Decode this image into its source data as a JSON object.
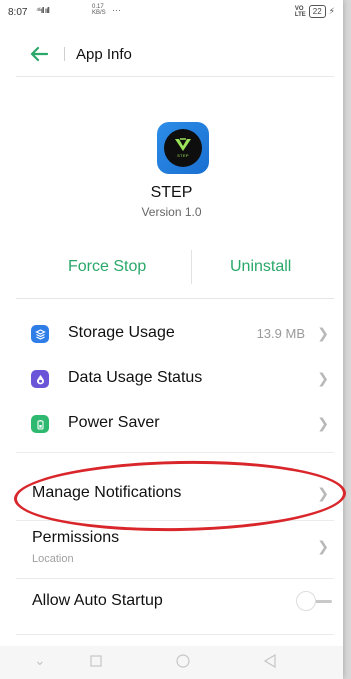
{
  "status_bar": {
    "time": "8:07",
    "network": "⁴⁶ıll ııll",
    "speed_top": "0.17",
    "speed_bottom": "KB/S",
    "dots": "···",
    "volte_top": "VO",
    "volte_bottom": "LTE",
    "battery": "22"
  },
  "header": {
    "title": "App Info",
    "back_icon": "arrow-left-icon"
  },
  "app": {
    "icon_text": "STEP",
    "name": "STEP",
    "version": "Version 1.0"
  },
  "actions": {
    "force_stop": "Force Stop",
    "uninstall": "Uninstall"
  },
  "settings": [
    {
      "label": "Storage Usage",
      "value": "13.9 MB",
      "icon": "storage-icon",
      "color": "#2f7ee8"
    },
    {
      "label": "Data Usage Status",
      "icon": "data-drop-icon",
      "color": "#6a55d8"
    },
    {
      "label": "Power Saver",
      "icon": "battery-icon",
      "color": "#2fb86f"
    }
  ],
  "more_settings": {
    "manage_notifications": "Manage Notifications",
    "permissions": "Permissions",
    "permissions_sub": "Location",
    "auto_startup": "Allow Auto Startup",
    "auto_startup_enabled": false
  },
  "colors": {
    "accent": "#2aa86a",
    "highlight": "#d9262b"
  }
}
